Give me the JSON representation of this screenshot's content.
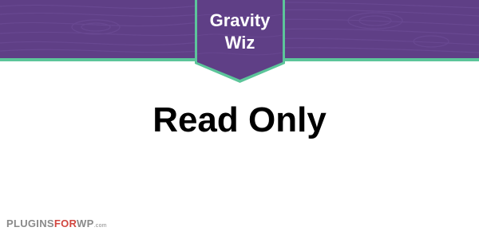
{
  "header": {
    "badge_line1": "Gravity",
    "badge_line2": "Wiz",
    "band_color": "#5f3f86",
    "accent_color": "#5cc59a"
  },
  "main": {
    "title": "Read Only"
  },
  "watermark": {
    "part1": "PLUGINS",
    "part2": "FOR",
    "part3": "WP",
    "part4": ".com",
    "accent_color": "#d1463f"
  }
}
